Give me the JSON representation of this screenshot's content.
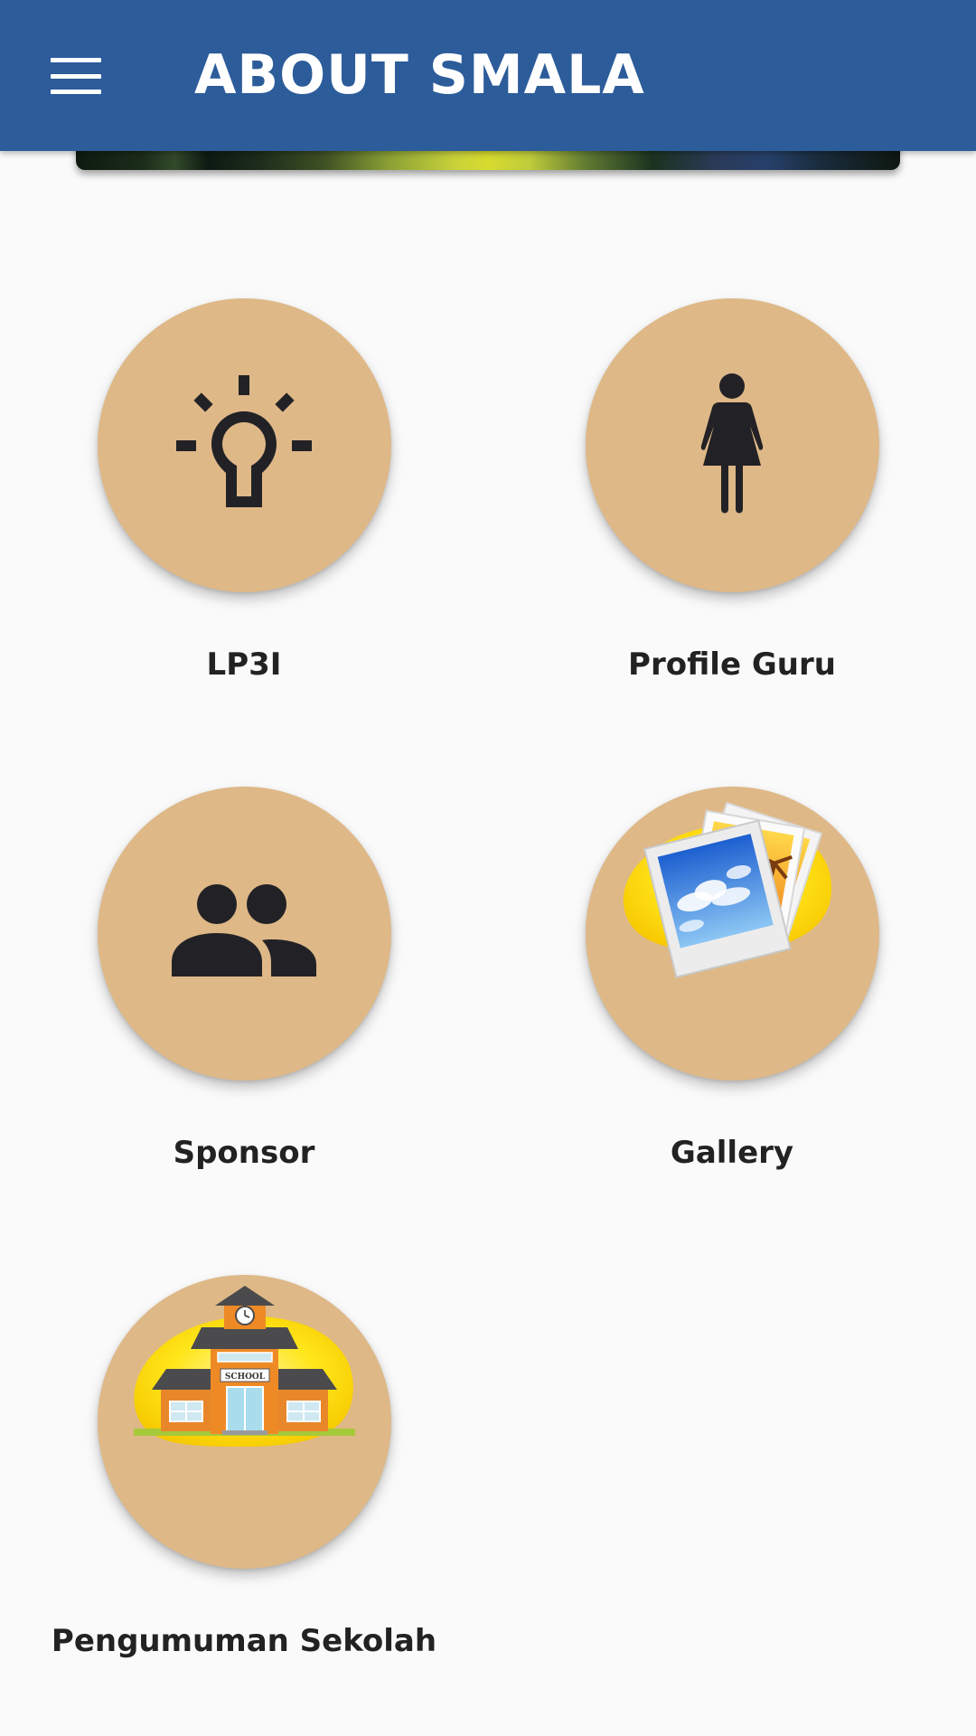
{
  "appbar": {
    "title": "ABOUT SMALA",
    "menu_icon": "hamburger-menu-icon",
    "background_color": "#2c5c9a",
    "title_color": "#ffffff"
  },
  "grid": {
    "circle_color": "#deb887",
    "items": [
      {
        "label": "LP3I",
        "icon": "lightbulb-icon"
      },
      {
        "label": "Profile Guru",
        "icon": "woman-icon"
      },
      {
        "label": "Sponsor",
        "icon": "people-icon"
      },
      {
        "label": "Gallery",
        "icon": "photos-icon"
      },
      {
        "label": "Pengumuman Sekolah",
        "icon": "school-building-icon"
      }
    ]
  }
}
